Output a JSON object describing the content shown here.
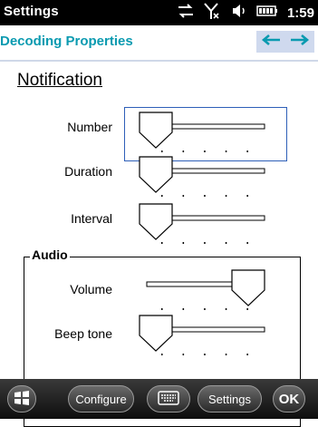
{
  "status_bar": {
    "title": "Settings",
    "time": "1:59"
  },
  "header": {
    "title": "Decoding Properties"
  },
  "notification": {
    "section_title": "Notification",
    "number_label": "Number",
    "duration_label": "Duration",
    "interval_label": "Interval",
    "number_level": 0,
    "duration_level": 0,
    "interval_level": 0
  },
  "audio": {
    "group_label": "Audio",
    "volume_label": "Volume",
    "beep_tone_label": "Beep tone",
    "volume_level": 1,
    "beep_tone_level": 0
  },
  "taskbar": {
    "configure_label": "Configure",
    "settings_label": "Settings",
    "ok_label": "OK"
  },
  "icons": [
    "connectivity-icon",
    "no-signal-icon",
    "volume-icon",
    "battery-icon",
    "back-arrow-icon",
    "forward-arrow-icon",
    "windows-start-icon",
    "keyboard-icon"
  ],
  "colors": {
    "accent": "#0a9ab0",
    "nav_bg": "#cfd9ee",
    "focus": "#2e5fb8"
  }
}
